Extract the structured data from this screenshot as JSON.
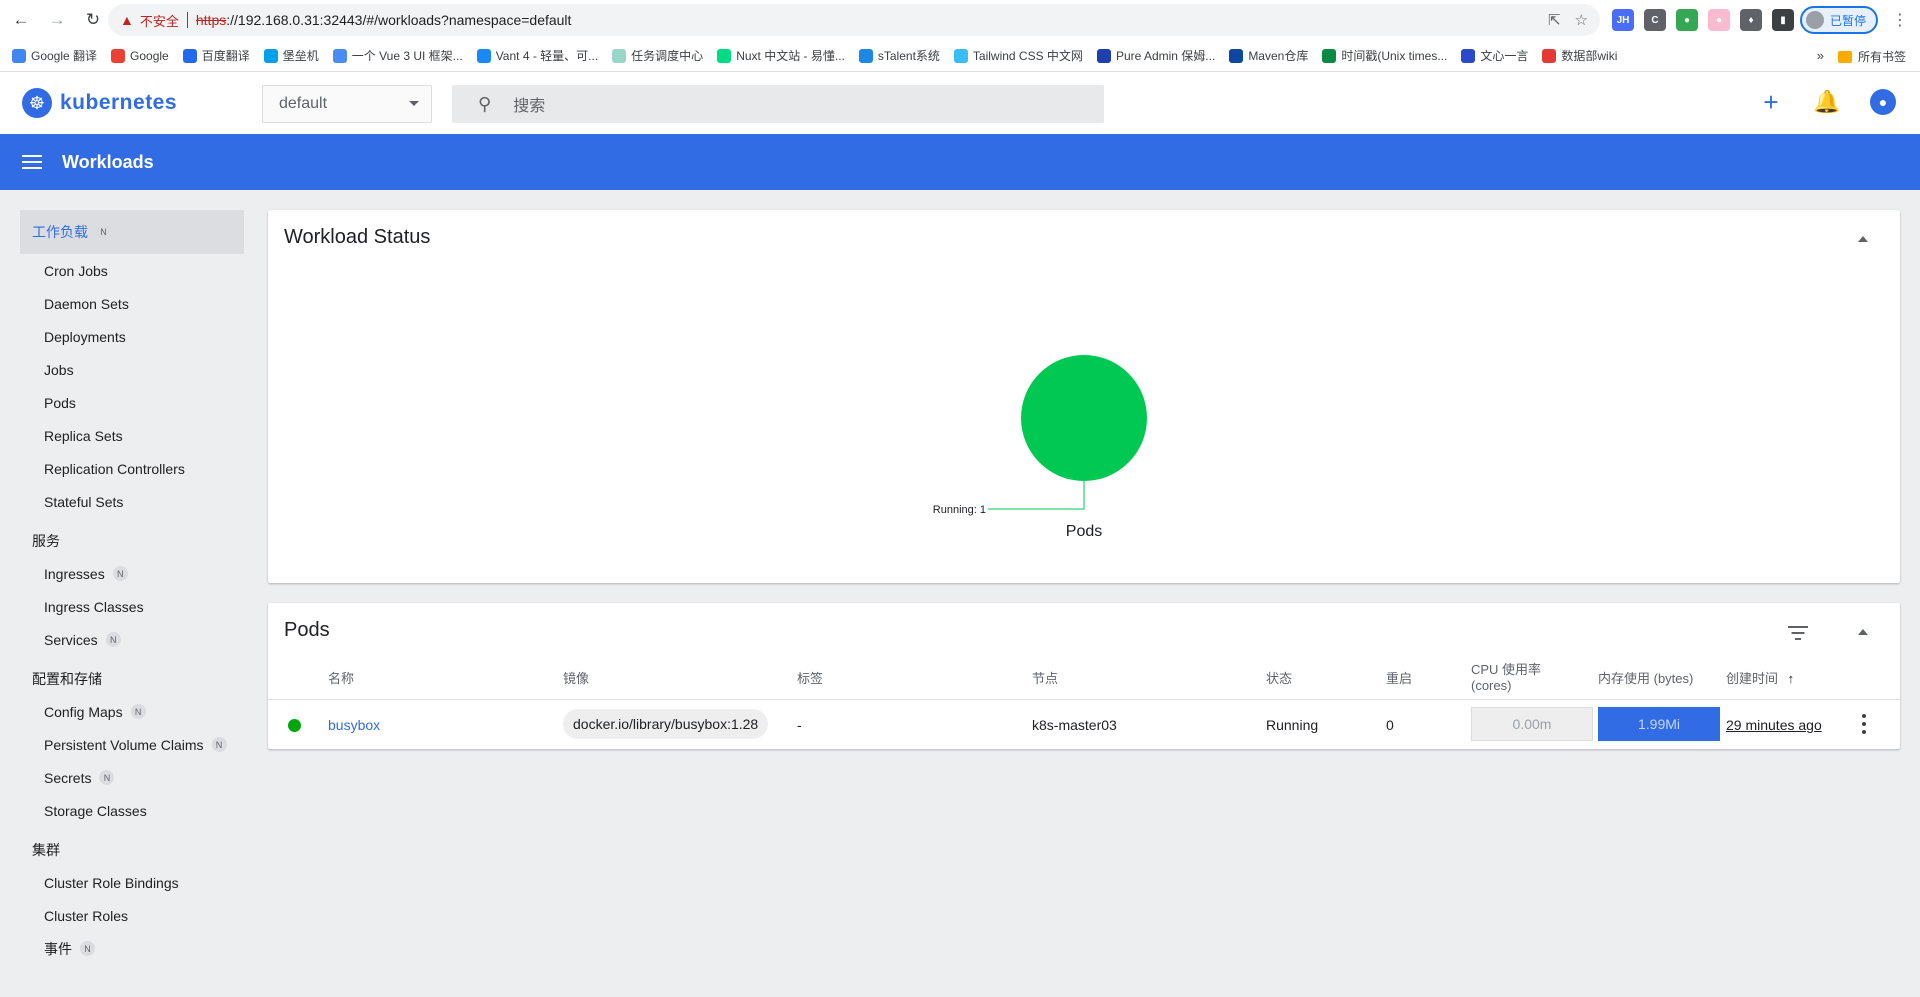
{
  "browser": {
    "insecure_label": "不安全",
    "url_scheme": "https",
    "url_rest": "://192.168.0.31:32443/#/workloads?namespace=default",
    "profile_status": "已暂停",
    "bookmarks": [
      {
        "label": "Google 翻译",
        "color": "#4285f4"
      },
      {
        "label": "Google",
        "color": "#ea4335"
      },
      {
        "label": "百度翻译",
        "color": "#2468f2"
      },
      {
        "label": "堡垒机",
        "color": "#00a0e9"
      },
      {
        "label": "一个 Vue 3 UI 框架...",
        "color": "#4b8bf5"
      },
      {
        "label": "Vant 4 - 轻量、可...",
        "color": "#1989fa"
      },
      {
        "label": "任务调度中心",
        "color": "#9ad6c8"
      },
      {
        "label": "Nuxt 中文站 - 易懂...",
        "color": "#00dc82"
      },
      {
        "label": "sTalent系统",
        "color": "#1e88e5"
      },
      {
        "label": "Tailwind CSS 中文网",
        "color": "#38bdf8"
      },
      {
        "label": "Pure Admin 保姆...",
        "color": "#1e40af"
      },
      {
        "label": "Maven仓库",
        "color": "#0d47a1"
      },
      {
        "label": "时间戳(Unix times...",
        "color": "#0a8a43"
      },
      {
        "label": "文心一言",
        "color": "#2b4acb"
      },
      {
        "label": "数据部wiki",
        "color": "#e53935"
      }
    ],
    "bookmarks_more": "»",
    "all_bookmarks": "所有书签"
  },
  "app": {
    "brand": "kubernetes",
    "namespace": "default",
    "search_placeholder": "搜索",
    "toolbar_title": "Workloads",
    "colors": {
      "primary": "#326ce5",
      "running": "#00c853",
      "status_dot": "#00a60e"
    }
  },
  "sidebar": {
    "active": {
      "label": "工作负载",
      "badge": "N"
    },
    "workloads": [
      "Cron Jobs",
      "Daemon Sets",
      "Deployments",
      "Jobs",
      "Pods",
      "Replica Sets",
      "Replication Controllers",
      "Stateful Sets"
    ],
    "service_section": "服务",
    "service_items": [
      {
        "label": "Ingresses",
        "badge": "N"
      },
      {
        "label": "Ingress Classes",
        "badge": ""
      },
      {
        "label": "Services",
        "badge": "N"
      }
    ],
    "config_section": "配置和存储",
    "config_items": [
      {
        "label": "Config Maps",
        "badge": "N"
      },
      {
        "label": "Persistent Volume Claims",
        "badge": "N"
      },
      {
        "label": "Secrets",
        "badge": "N"
      },
      {
        "label": "Storage Classes",
        "badge": ""
      }
    ],
    "cluster_section": "集群",
    "cluster_items": [
      {
        "label": "Cluster Role Bindings",
        "badge": ""
      },
      {
        "label": "Cluster Roles",
        "badge": ""
      },
      {
        "label": "事件",
        "badge": "N"
      }
    ]
  },
  "workload_status": {
    "title": "Workload Status",
    "chart_data": {
      "type": "pie",
      "title": "Pods",
      "slices": [
        {
          "label": "Running",
          "value": 1
        }
      ]
    }
  },
  "pods": {
    "title": "Pods",
    "headers": [
      "名称",
      "镜像",
      "标签",
      "节点",
      "状态",
      "重启",
      "CPU 使用率 (cores)",
      "内存使用 (bytes)",
      "创建时间"
    ],
    "sort_indicator": "↑",
    "rows": [
      {
        "name": "busybox",
        "image": "docker.io/library/busybox:1.28",
        "labels": "-",
        "node": "k8s-master03",
        "status": "Running",
        "restarts": "0",
        "cpu": "0.00m",
        "memory": "1.99Mi",
        "memory_fill": 1.0,
        "created": "29 minutes ago"
      }
    ]
  }
}
